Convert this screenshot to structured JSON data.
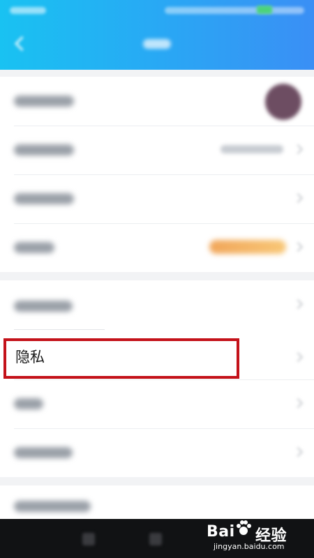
{
  "privacy_item": {
    "label": "隐私"
  },
  "watermark": {
    "brand_left": "Bai",
    "brand_right": "经验",
    "url": "jingyan.baidu.com"
  },
  "colors": {
    "header_start": "#19c2f2",
    "header_end": "#3a8ff5",
    "highlight_border": "#c4121a",
    "bottom_bar": "#111214"
  },
  "icons": [
    "back-arrow-icon",
    "chevron-right-icon",
    "baidu-paw-icon"
  ]
}
